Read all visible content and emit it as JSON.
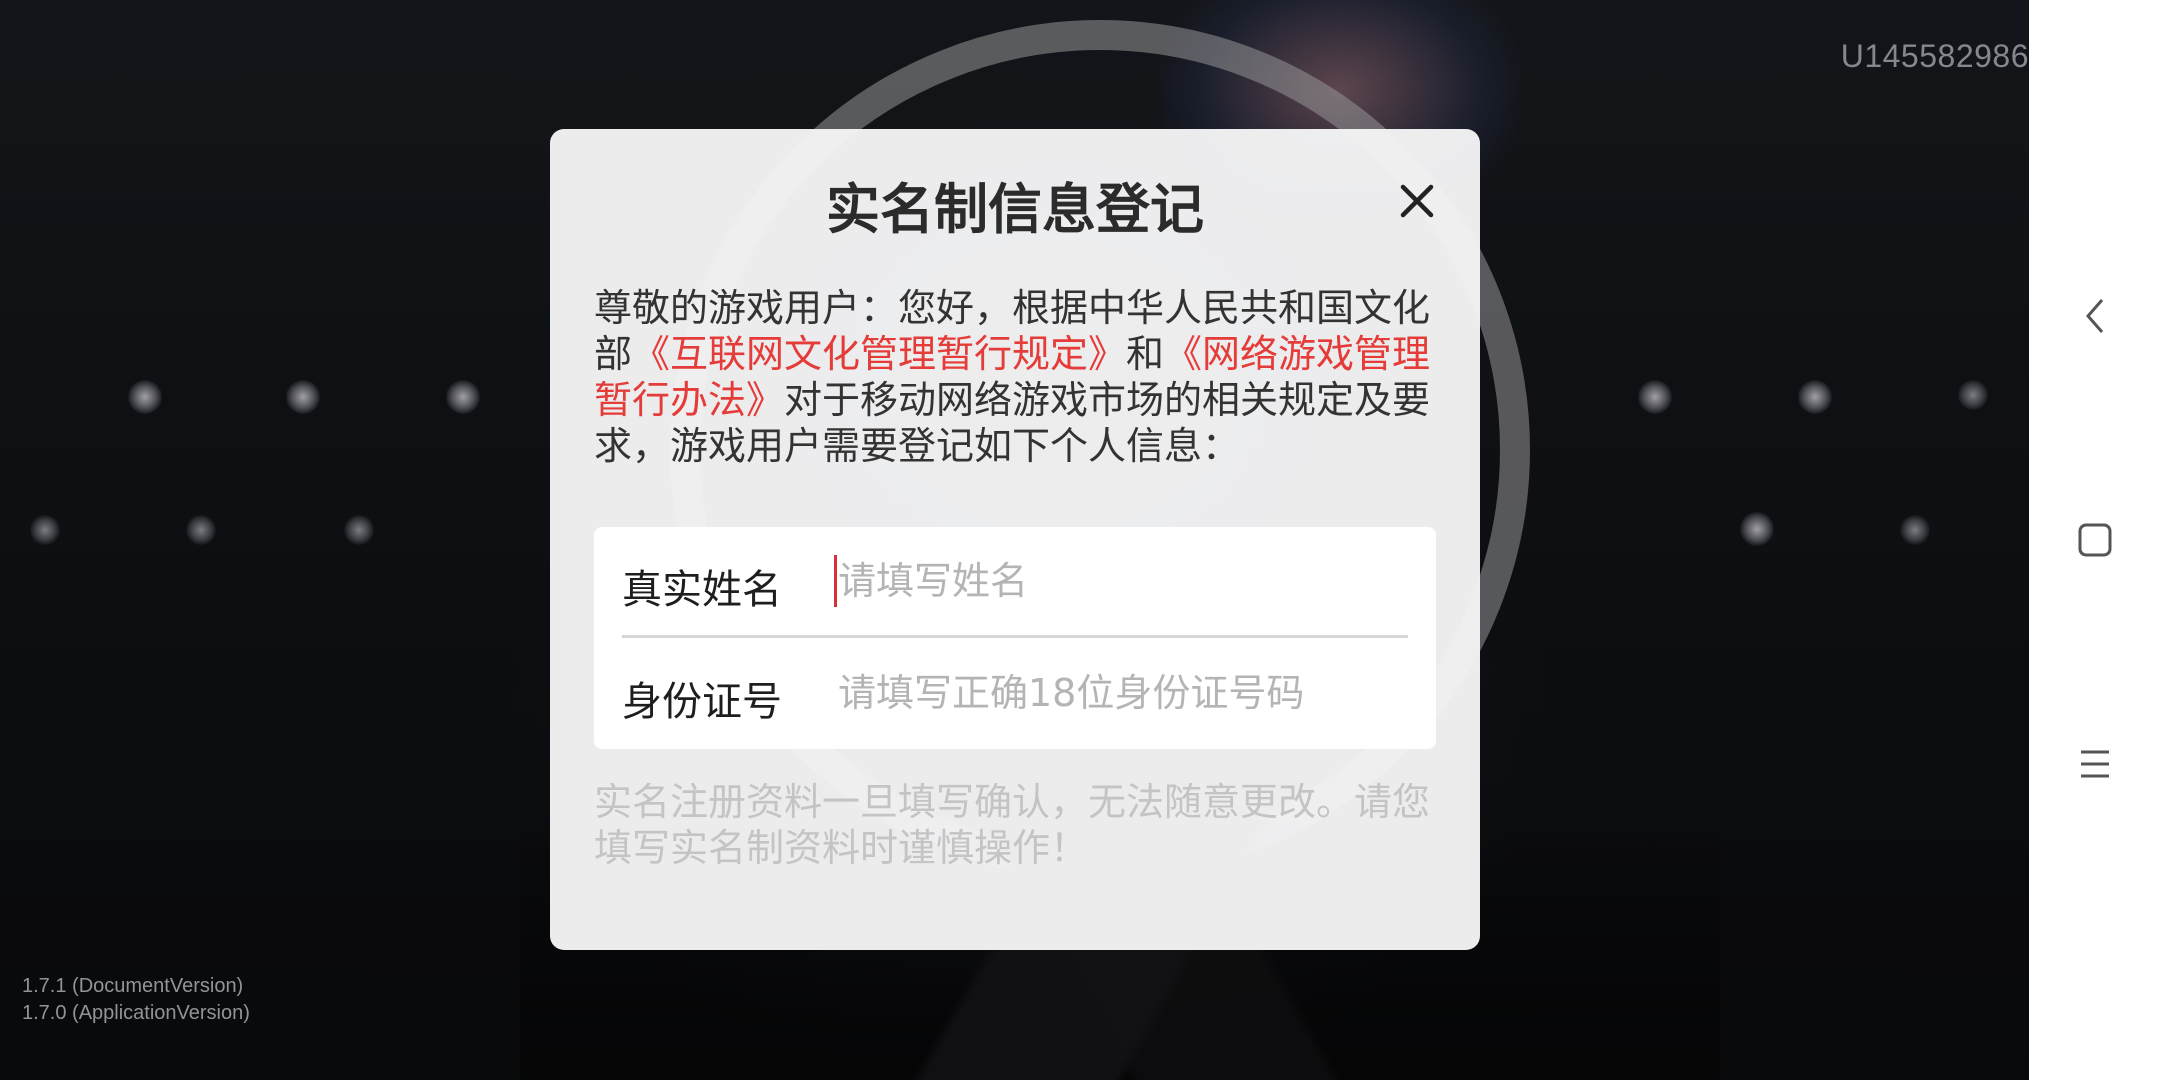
{
  "uid": "U145582986",
  "versions": {
    "document": "1.7.1 (DocumentVersion)",
    "application": "1.7.0 (ApplicationVersion)"
  },
  "dialog": {
    "title": "实名制信息登记",
    "notice": {
      "part1": "尊敬的游戏用户：您好，根据中华人民共和国文化部",
      "link1": "《互联网文化管理暂行规定》",
      "part2": "和",
      "link2": "《网络游戏管理暂行办法》",
      "part3": "对于移动网络游戏市场的相关规定及要求，游戏用户需要登记如下个人信息："
    },
    "fields": [
      {
        "label": "真实姓名",
        "value": "",
        "placeholder": "请填写姓名"
      },
      {
        "label": "身份证号",
        "value": "",
        "placeholder": "请填写正确18位身份证号码"
      }
    ],
    "warning": "实名注册资料一旦填写确认，无法随意更改。请您填写实名制资料时谨慎操作！"
  },
  "colors": {
    "link": "#e53b39",
    "caret": "#d8303a",
    "dialog_bg": "#f4f4f5"
  },
  "icons": {
    "close": "close-icon",
    "back": "nav-back-icon",
    "home": "nav-home-icon",
    "menu": "nav-menu-icon"
  }
}
